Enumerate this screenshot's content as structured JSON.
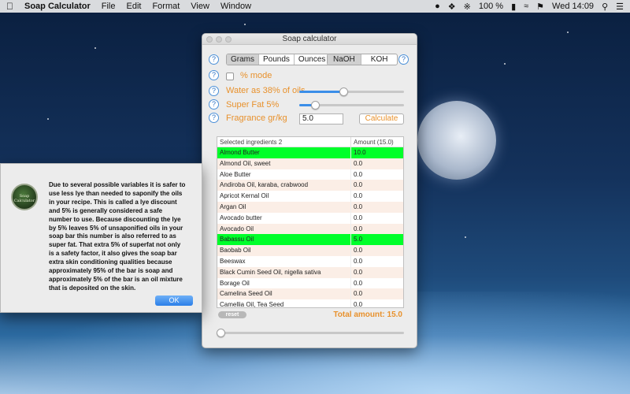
{
  "menubar": {
    "app_name": "Soap Calculator",
    "menus": [
      "File",
      "Edit",
      "Format",
      "View",
      "Window"
    ],
    "battery": "100 %",
    "clock": "Wed 14:09"
  },
  "window": {
    "title": "Soap calculator",
    "units": [
      "Grams",
      "Pounds",
      "Ounces"
    ],
    "units_selected": "Grams",
    "lye": [
      "NaOH",
      "KOH"
    ],
    "lye_selected": "NaOH",
    "percent_mode_label": "% mode",
    "percent_mode_checked": false,
    "water_label": "Water as 38% of oils",
    "water_slider_value": 0.38,
    "superfat_label": "Super Fat 5%",
    "superfat_slider_value": 0.05,
    "fragrance_label": "Fragrance gr/kg",
    "fragrance_value": "5.0",
    "calculate_label": "Calculate",
    "help_symbol": "?",
    "table": {
      "header_name": "Selected ingredients 2",
      "header_amount": "Amount (15.0)",
      "rows": [
        {
          "name": "Almond Butter",
          "amount": "10.0",
          "selected": true
        },
        {
          "name": "Almond Oil, sweet",
          "amount": "0.0",
          "selected": false
        },
        {
          "name": "Aloe Butter",
          "amount": "0.0",
          "selected": false
        },
        {
          "name": "Andiroba Oil, karaba, crabwood",
          "amount": "0.0",
          "selected": false
        },
        {
          "name": "Apricot Kernal Oil",
          "amount": "0.0",
          "selected": false
        },
        {
          "name": "Argan Oil",
          "amount": "0.0",
          "selected": false
        },
        {
          "name": "Avocado butter",
          "amount": "0.0",
          "selected": false
        },
        {
          "name": "Avocado Oil",
          "amount": "0.0",
          "selected": false
        },
        {
          "name": "Babassu Oil",
          "amount": "5.0",
          "selected": true
        },
        {
          "name": "Baobab Oil",
          "amount": "0.0",
          "selected": false
        },
        {
          "name": "Beeswax",
          "amount": "0.0",
          "selected": false
        },
        {
          "name": "Black Cumin Seed Oil, nigella sativa",
          "amount": "0.0",
          "selected": false
        },
        {
          "name": "Borage Oil",
          "amount": "0.0",
          "selected": false
        },
        {
          "name": "Camelina Seed Oil",
          "amount": "0.0",
          "selected": false
        },
        {
          "name": "Camellia Oil, Tea Seed",
          "amount": "0.0",
          "selected": false
        }
      ]
    },
    "reset_label": "reset",
    "total_label": "Total amount: 15.0"
  },
  "alert": {
    "icon_text": "Soap Calculator",
    "message": "Due to several possible variables it is safer to use less lye than needed to saponify the oils in your recipe. This is called a lye discount and 5% is generally considered a safe number to use.  Because discounting the lye by 5% leaves 5% of unsaponified oils in your soap bar this number is also referred to as super fat. That extra 5% of superfat not only is a safety factor, it also gives the soap bar extra skin conditioning qualities because approximately 95% of the bar is soap and approximately 5% of the bar is an oil mixture that is deposited on the skin.",
    "ok_label": "OK"
  },
  "colors": {
    "accent_orange": "#e8912c",
    "highlight_green": "#00ff2a",
    "help_blue": "#2d72c4"
  }
}
